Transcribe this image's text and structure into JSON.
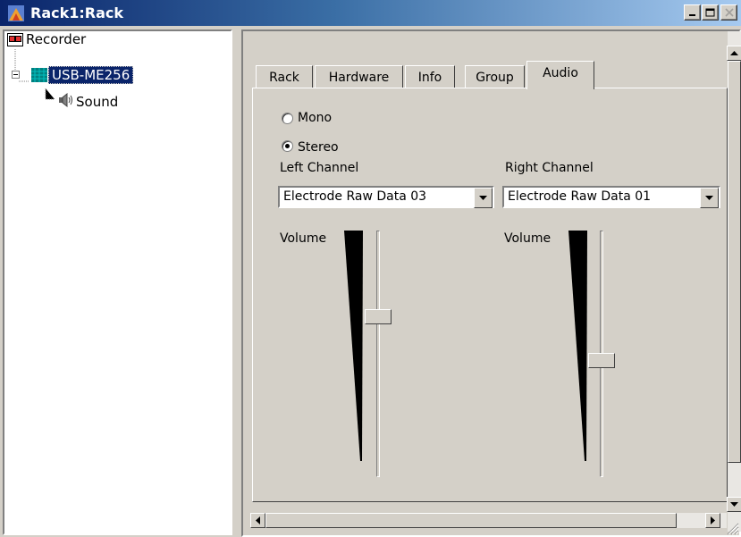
{
  "window": {
    "title": "Rack1:Rack",
    "minimize_label": "_",
    "maximize_label": "□",
    "close_label": "×"
  },
  "tree": {
    "items": [
      {
        "label": "Recorder",
        "icon": "recorder-icon"
      },
      {
        "label": "USB-ME256",
        "icon": "device-icon",
        "selected": true
      },
      {
        "label": "Sound",
        "icon": "speaker-icon"
      }
    ]
  },
  "tabs": [
    {
      "label": "Rack"
    },
    {
      "label": "Hardware"
    },
    {
      "label": "Info"
    },
    {
      "label": "Group"
    },
    {
      "label": "Audio",
      "active": true
    }
  ],
  "audio": {
    "mode_options": [
      {
        "label": "Mono",
        "checked": false
      },
      {
        "label": "Stereo",
        "checked": true
      }
    ],
    "left": {
      "channel_label": "Left Channel",
      "channel_value": "Electrode Raw Data 03",
      "volume_label": "Volume",
      "volume_level": 0.66
    },
    "right": {
      "channel_label": "Right Channel",
      "channel_value": "Electrode Raw Data 01",
      "volume_label": "Volume",
      "volume_level": 0.47
    }
  },
  "colors": {
    "title_gradient_start": "#0a246a",
    "title_gradient_end": "#a6caf0",
    "selection": "#0a246a",
    "face": "#d4d0c8"
  }
}
